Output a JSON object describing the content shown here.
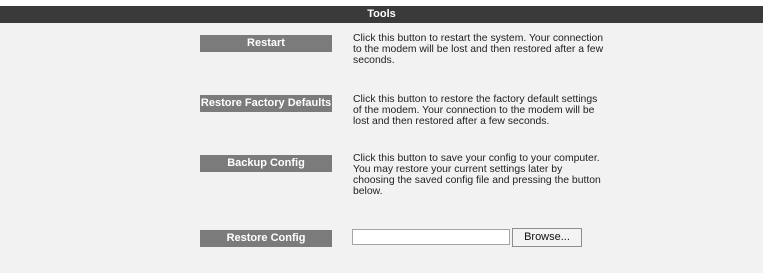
{
  "section": {
    "title": "Tools"
  },
  "tools": {
    "restart": {
      "button_label": "Restart",
      "description_lines": [
        "Click this button to restart the system. Your connection",
        "to the modem will be lost and then restored after a few",
        "seconds."
      ]
    },
    "factory_defaults": {
      "button_label": "Restore Factory Defaults",
      "description_lines": [
        "Click this button to restore the factory default settings",
        "of the modem. Your connection to the modem will be",
        "lost and then restored after a few seconds."
      ]
    },
    "backup": {
      "button_label": "Backup Config",
      "description_lines": [
        "Click this button to save your config to your computer.",
        "You may restore your current settings later by",
        "choosing the saved config file and pressing the button",
        "below."
      ]
    },
    "restore": {
      "button_label": "Restore Config",
      "file_input_value": "",
      "browse_label": "Browse..."
    }
  },
  "colors": {
    "title_bar": "#3a3a3a",
    "button": "#7b7b7b",
    "panel": "#f2f2f2"
  }
}
